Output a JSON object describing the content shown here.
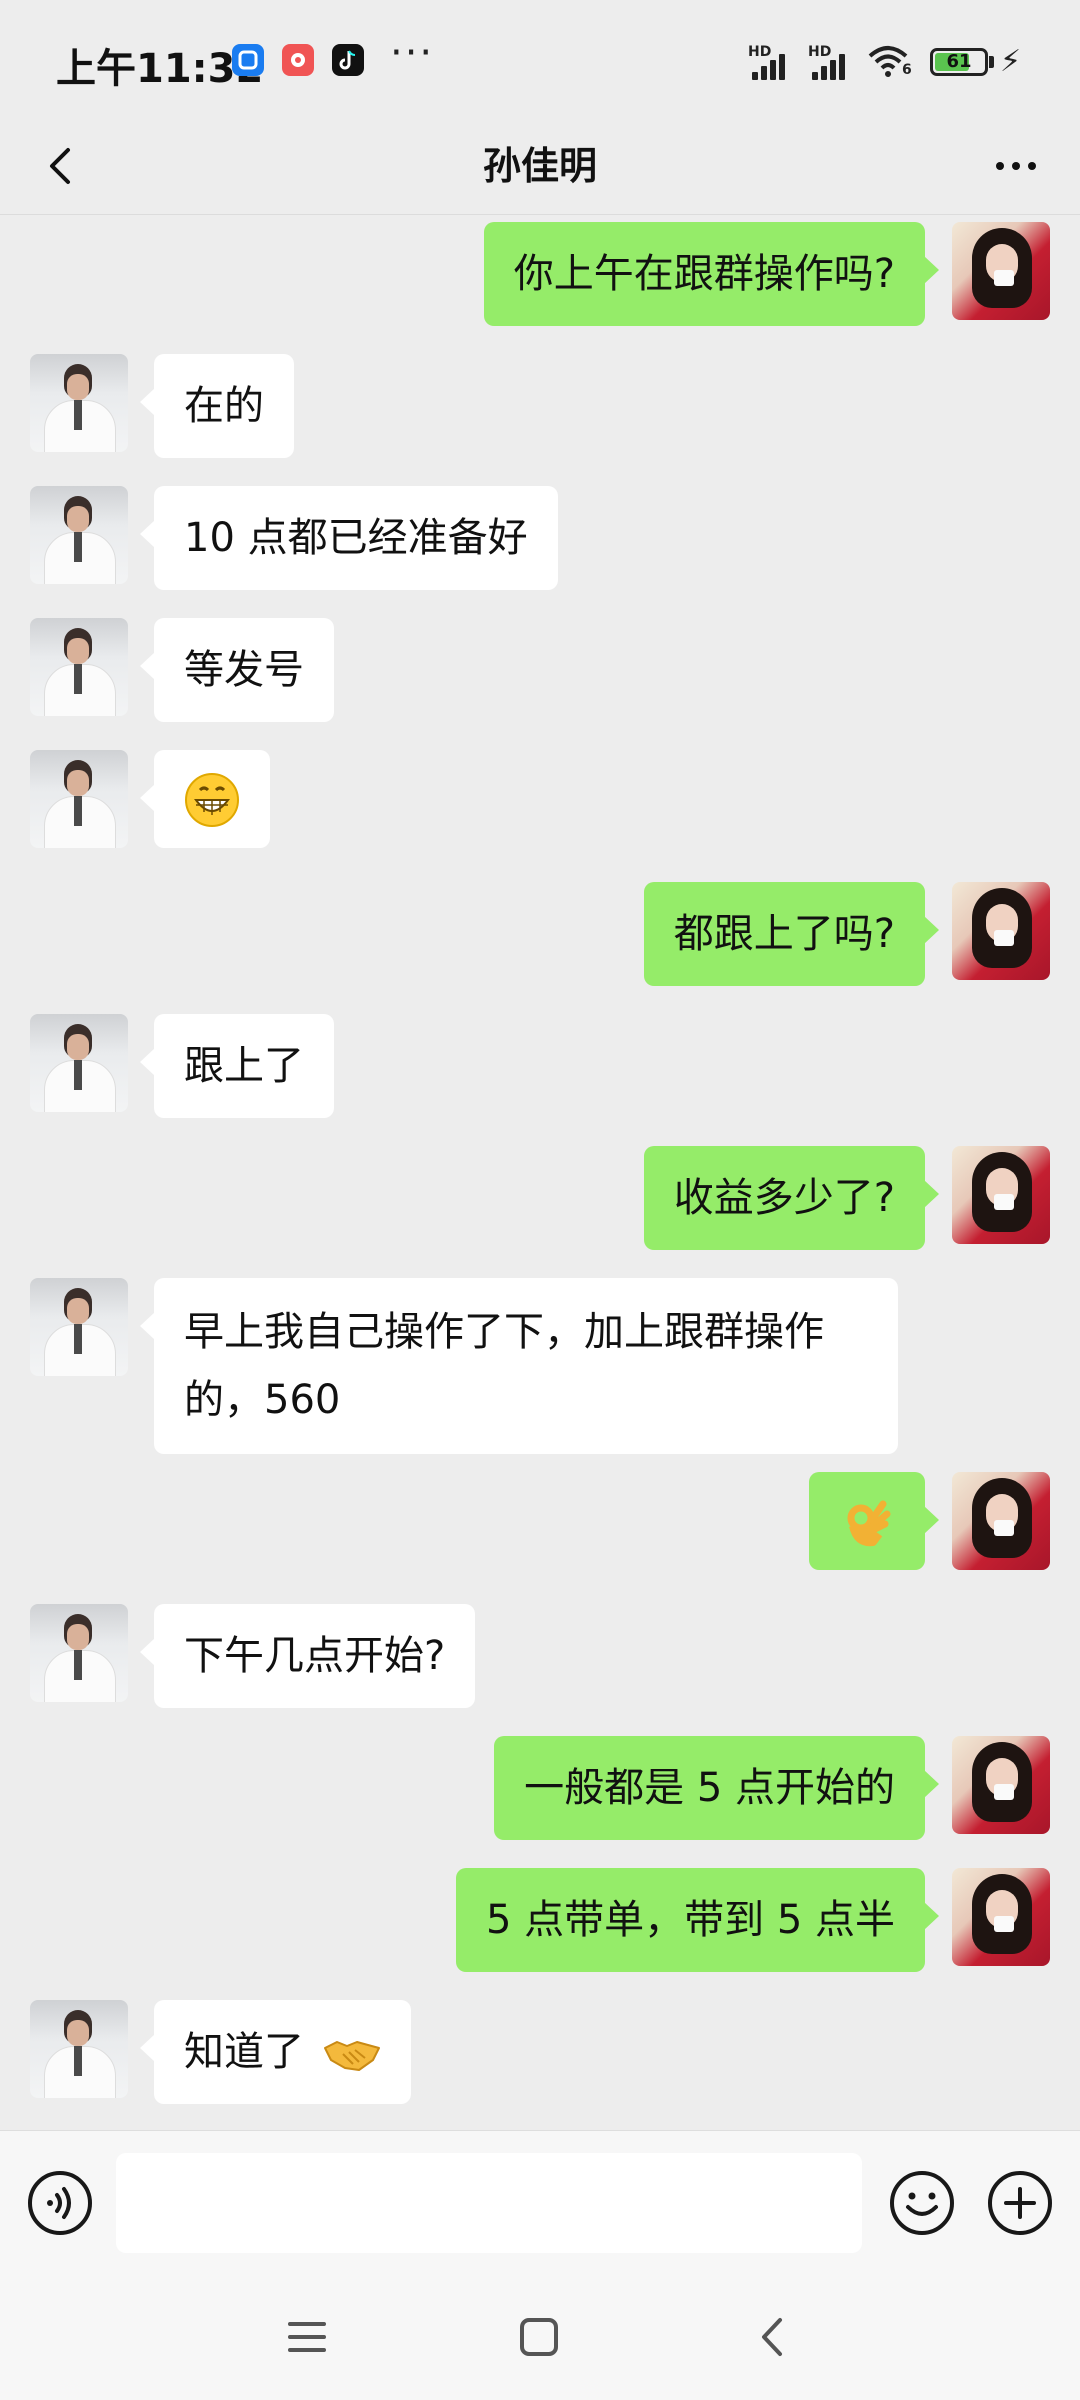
{
  "status": {
    "time": "上午11:32",
    "dots": "···",
    "signal1": "HD",
    "signal2": "HD",
    "wifi_label": "6",
    "battery": "61",
    "app_icons": [
      "blue-app-icon",
      "red-app-icon",
      "tiktok-icon"
    ]
  },
  "header": {
    "title": "孙佳明",
    "back_icon": "chevron-left-icon",
    "more_icon": "more-dots-icon"
  },
  "messages": [
    {
      "sender": "me",
      "text": "你上午在跟群操作吗?"
    },
    {
      "sender": "other",
      "text": "在的"
    },
    {
      "sender": "other",
      "text": "10 点都已经准备好"
    },
    {
      "sender": "other",
      "text": "等发号"
    },
    {
      "sender": "other",
      "text": "",
      "emoji": "grin-emoji"
    },
    {
      "sender": "me",
      "text": "都跟上了吗?"
    },
    {
      "sender": "other",
      "text": "跟上了"
    },
    {
      "sender": "me",
      "text": "收益多少了?"
    },
    {
      "sender": "other",
      "text": "早上我自己操作了下，加上跟群操作的，560"
    },
    {
      "sender": "me",
      "text": "",
      "emoji": "ok-hand-emoji"
    },
    {
      "sender": "other",
      "text": "下午几点开始?"
    },
    {
      "sender": "me",
      "text": "一般都是 5 点开始的"
    },
    {
      "sender": "me",
      "text": "5 点带单，带到 5 点半"
    },
    {
      "sender": "other",
      "text": "知道了",
      "emoji": "handshake-emoji"
    }
  ],
  "input": {
    "value": "",
    "placeholder": ""
  },
  "colors": {
    "background": "#ededed",
    "my_bubble": "#95ec69",
    "other_bubble": "#ffffff"
  }
}
